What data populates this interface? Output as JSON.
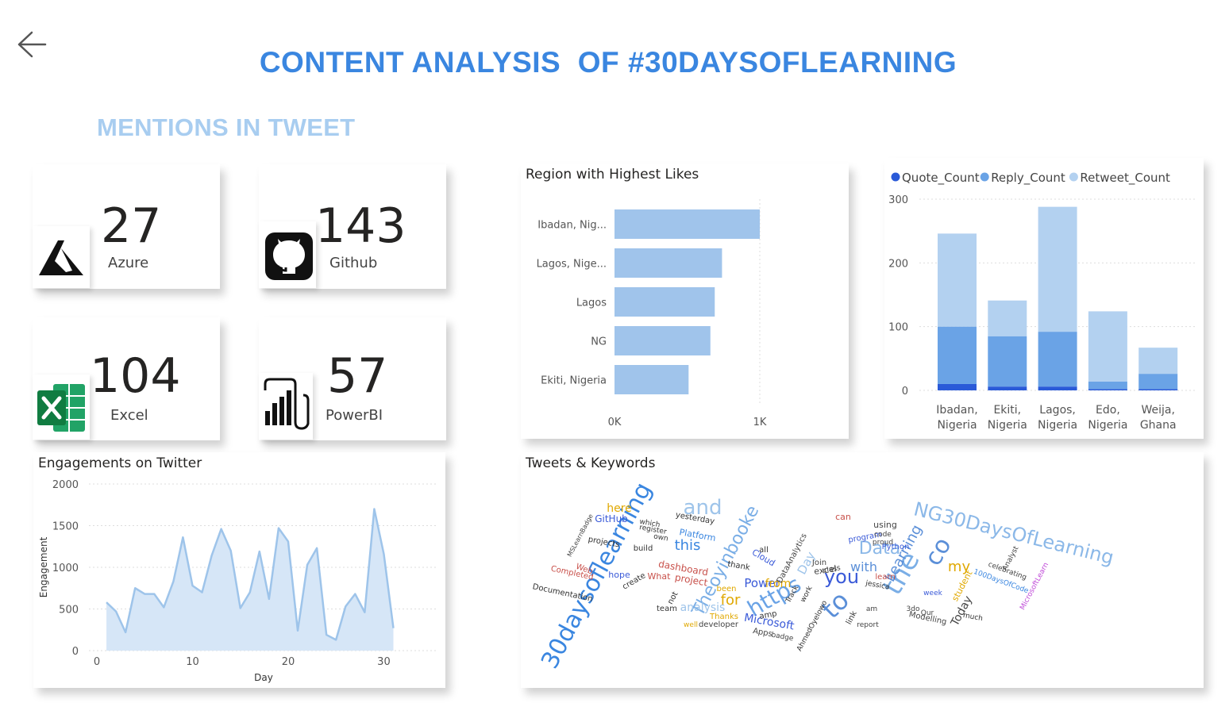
{
  "header": {
    "title": "CONTENT ANALYSIS  OF #30DAYSOFLEARNING",
    "subtitle": "MENTIONS IN TWEET"
  },
  "kpis": [
    {
      "value": "27",
      "label": "Azure",
      "icon": "azure-icon"
    },
    {
      "value": "143",
      "label": "Github",
      "icon": "github-icon"
    },
    {
      "value": "104",
      "label": "Excel",
      "icon": "excel-icon"
    },
    {
      "value": "57",
      "label": "PowerBI",
      "icon": "powerbi-icon"
    }
  ],
  "colors": {
    "title": "#3a86e0",
    "subtitle": "#a8cdf0",
    "bar": "#a0c4eb",
    "quote": "#2a5ad8",
    "reply": "#6aa3e6",
    "retweet": "#b3d1f0",
    "line": "#9ec4ea",
    "area": "#d6e6f7"
  },
  "chart_data": [
    {
      "id": "region_likes",
      "type": "bar",
      "orientation": "horizontal",
      "title": "Region with Highest Likes",
      "categories": [
        "Ibadan, Nig...",
        "Lagos, Nige...",
        "Lagos",
        "NG",
        "Ekiti, Nigeria"
      ],
      "values": [
        1000,
        740,
        690,
        660,
        510
      ],
      "xlim": [
        0,
        1000
      ],
      "xticks": [
        "0K",
        "1K"
      ]
    },
    {
      "id": "engagement_counts",
      "type": "bar",
      "stacked": true,
      "legend": "top-left",
      "categories": [
        "Ibadan, Nigeria",
        "Ekiti, Nigeria",
        "Lagos, Nigeria",
        "Edo, Nigeria",
        "Weija, Ghana"
      ],
      "category_lines": [
        [
          "Ibadan,",
          "Nigeria"
        ],
        [
          "Ekiti,",
          "Nigeria"
        ],
        [
          "Lagos,",
          "Nigeria"
        ],
        [
          "Edo,",
          "Nigeria"
        ],
        [
          "Weija,",
          "Ghana"
        ]
      ],
      "series": [
        {
          "name": "Quote_Count",
          "values": [
            10,
            6,
            6,
            2,
            2
          ]
        },
        {
          "name": "Reply_Count",
          "values": [
            90,
            79,
            86,
            12,
            24
          ]
        },
        {
          "name": "Retweet_Count",
          "values": [
            146,
            56,
            196,
            110,
            41
          ]
        }
      ],
      "ylim": [
        0,
        300
      ],
      "yticks": [
        0,
        100,
        200,
        300
      ]
    },
    {
      "id": "engagements_twitter",
      "type": "area",
      "title": "Engagements on Twitter",
      "xlabel": "Day",
      "ylabel": "Engagement",
      "xlim": [
        0,
        35
      ],
      "ylim": [
        0,
        2000
      ],
      "xticks": [
        0,
        10,
        20,
        30
      ],
      "yticks": [
        0,
        500,
        1000,
        1500,
        2000
      ],
      "x": [
        1,
        2,
        3,
        4,
        5,
        6,
        7,
        8,
        9,
        10,
        11,
        12,
        13,
        14,
        15,
        16,
        17,
        18,
        19,
        20,
        21,
        22,
        23,
        24,
        25,
        26,
        27,
        28,
        29,
        30,
        31
      ],
      "y": [
        580,
        470,
        220,
        750,
        680,
        680,
        520,
        830,
        1360,
        780,
        700,
        1140,
        1460,
        1200,
        510,
        700,
        1190,
        620,
        1470,
        1310,
        240,
        1030,
        1230,
        190,
        130,
        530,
        680,
        460,
        1700,
        1160,
        270
      ]
    }
  ],
  "wordcloud": {
    "title": "Tweets & Keywords",
    "words": [
      {
        "t": "30daysoflearning",
        "x": 760,
        "y": 730,
        "s": 30,
        "r": -62,
        "c": "#3a86e0"
      },
      {
        "t": "NG30DaysOfLearning",
        "x": 1275,
        "y": 680,
        "s": 24,
        "r": 14,
        "c": "#8bb8e8"
      },
      {
        "t": "the",
        "x": 1145,
        "y": 728,
        "s": 34,
        "r": -60,
        "c": "#7aaee6"
      },
      {
        "t": "to",
        "x": 1060,
        "y": 770,
        "s": 32,
        "r": -45,
        "c": "#5b8fd8"
      },
      {
        "t": "co",
        "x": 1190,
        "y": 700,
        "s": 30,
        "r": -60,
        "c": "#5b8fd8"
      },
      {
        "t": "https",
        "x": 980,
        "y": 760,
        "s": 28,
        "r": -30,
        "c": "#6aa3e6"
      },
      {
        "t": "you",
        "x": 1060,
        "y": 735,
        "s": 24,
        "r": 0,
        "c": "#3a5ad8"
      },
      {
        "t": "and",
        "x": 885,
        "y": 648,
        "s": 26,
        "r": 0,
        "c": "#9ec4ea"
      },
      {
        "t": "Theoyinbooke",
        "x": 920,
        "y": 710,
        "s": 22,
        "r": -62,
        "c": "#7aaee6"
      },
      {
        "t": "Data",
        "x": 1108,
        "y": 698,
        "s": 22,
        "r": 0,
        "c": "#8bb8e8"
      },
      {
        "t": "Learning",
        "x": 1143,
        "y": 700,
        "s": 18,
        "r": -62,
        "c": "#5b8fd8"
      },
      {
        "t": "this",
        "x": 866,
        "y": 693,
        "s": 18,
        "r": 0,
        "c": "#3a86e0"
      },
      {
        "t": "for",
        "x": 920,
        "y": 762,
        "s": 18,
        "r": 0,
        "c": "#e0a800"
      },
      {
        "t": "Power",
        "x": 960,
        "y": 740,
        "s": 15,
        "r": 0,
        "c": "#3a5ad8"
      },
      {
        "t": "Microsoft",
        "x": 968,
        "y": 788,
        "s": 14,
        "r": 10,
        "c": "#3a5ad8"
      },
      {
        "t": "analysis",
        "x": 885,
        "y": 770,
        "s": 14,
        "r": 0,
        "c": "#9ec4ea"
      },
      {
        "t": "with",
        "x": 1088,
        "y": 720,
        "s": 16,
        "r": 0,
        "c": "#5b8fd8"
      },
      {
        "t": "here",
        "x": 780,
        "y": 645,
        "s": 14,
        "r": 0,
        "c": "#e0a800"
      },
      {
        "t": "GitHub",
        "x": 770,
        "y": 658,
        "s": 12,
        "r": 0,
        "c": "#3a5ad8"
      },
      {
        "t": "Documentation",
        "x": 708,
        "y": 750,
        "s": 10,
        "r": 12,
        "c": "#333"
      },
      {
        "t": "Platform",
        "x": 878,
        "y": 678,
        "s": 11,
        "r": 10,
        "c": "#3a86e0"
      },
      {
        "t": "dashboard",
        "x": 860,
        "y": 720,
        "s": 12,
        "r": 10,
        "c": "#c8504a"
      },
      {
        "t": "project",
        "x": 870,
        "y": 735,
        "s": 12,
        "r": 10,
        "c": "#c8504a"
      },
      {
        "t": "my",
        "x": 1208,
        "y": 720,
        "s": 18,
        "r": 0,
        "c": "#e0a800"
      },
      {
        "t": "Today",
        "x": 1215,
        "y": 772,
        "s": 14,
        "r": -62,
        "c": "#444"
      },
      {
        "t": "Python",
        "x": 1128,
        "y": 692,
        "s": 10,
        "r": 0,
        "c": "#3a5ad8"
      },
      {
        "t": "program",
        "x": 1090,
        "y": 680,
        "s": 10,
        "r": -10,
        "c": "#3a5ad8"
      },
      {
        "t": "excel",
        "x": 1040,
        "y": 722,
        "s": 11,
        "r": -8,
        "c": "#444"
      },
      {
        "t": "Cloud",
        "x": 960,
        "y": 706,
        "s": 11,
        "r": 30,
        "c": "#3a5ad8"
      },
      {
        "t": "from",
        "x": 980,
        "y": 740,
        "s": 14,
        "r": 0,
        "c": "#e0a800"
      },
      {
        "t": "student",
        "x": 1215,
        "y": 740,
        "s": 11,
        "r": -62,
        "c": "#e0a800"
      },
      {
        "t": "yesterday",
        "x": 875,
        "y": 656,
        "s": 10,
        "r": 10,
        "c": "#333"
      },
      {
        "t": "projects",
        "x": 760,
        "y": 686,
        "s": 10,
        "r": 10,
        "c": "#333"
      },
      {
        "t": "Completed",
        "x": 720,
        "y": 725,
        "s": 10,
        "r": 12,
        "c": "#c8504a"
      },
      {
        "t": "MicrosoftLearn",
        "x": 1305,
        "y": 740,
        "s": 9,
        "r": -62,
        "c": "#c04bd8"
      },
      {
        "t": "100DaysOfCode",
        "x": 1260,
        "y": 735,
        "s": 9,
        "r": 20,
        "c": "#3a86e0"
      },
      {
        "t": "celebrating",
        "x": 1268,
        "y": 722,
        "s": 9,
        "r": 20,
        "c": "#444"
      },
      {
        "t": "Analyst",
        "x": 1275,
        "y": 705,
        "s": 9,
        "r": -62,
        "c": "#444"
      },
      {
        "t": "Modelling",
        "x": 1168,
        "y": 782,
        "s": 10,
        "r": 12,
        "c": "#444"
      },
      {
        "t": "learn",
        "x": 1115,
        "y": 730,
        "s": 10,
        "r": 0,
        "c": "#c8504a"
      },
      {
        "t": "jessica",
        "x": 1105,
        "y": 740,
        "s": 9,
        "r": 10,
        "c": "#333"
      },
      {
        "t": "build",
        "x": 810,
        "y": 694,
        "s": 10,
        "r": 0,
        "c": "#333"
      },
      {
        "t": "create",
        "x": 800,
        "y": 735,
        "s": 10,
        "r": -30,
        "c": "#333"
      },
      {
        "t": "amp",
        "x": 968,
        "y": 778,
        "s": 10,
        "r": -10,
        "c": "#333"
      },
      {
        "t": "Apps",
        "x": 960,
        "y": 800,
        "s": 10,
        "r": 10,
        "c": "#444"
      },
      {
        "t": "badge",
        "x": 985,
        "y": 805,
        "s": 9,
        "r": 10,
        "c": "#444"
      },
      {
        "t": "developer",
        "x": 905,
        "y": 790,
        "s": 10,
        "r": 0,
        "c": "#444"
      },
      {
        "t": "Thanks",
        "x": 912,
        "y": 780,
        "s": 10,
        "r": 0,
        "c": "#e0a800"
      },
      {
        "t": "well",
        "x": 870,
        "y": 790,
        "s": 9,
        "r": 0,
        "c": "#e0a800"
      },
      {
        "t": "team",
        "x": 840,
        "y": 770,
        "s": 10,
        "r": 0,
        "c": "#333"
      },
      {
        "t": "not",
        "x": 850,
        "y": 755,
        "s": 10,
        "r": -62,
        "c": "#333"
      },
      {
        "t": "What",
        "x": 830,
        "y": 730,
        "s": 11,
        "r": 0,
        "c": "#c8504a"
      },
      {
        "t": "hope",
        "x": 780,
        "y": 728,
        "s": 11,
        "r": 0,
        "c": "#3a5ad8"
      },
      {
        "t": "Web",
        "x": 735,
        "y": 720,
        "s": 10,
        "r": 20,
        "c": "#c8504a"
      },
      {
        "t": "MSLearnBadge",
        "x": 733,
        "y": 676,
        "s": 8,
        "r": -62,
        "c": "#444"
      },
      {
        "t": "which",
        "x": 818,
        "y": 662,
        "s": 9,
        "r": 10,
        "c": "#333"
      },
      {
        "t": "register",
        "x": 822,
        "y": 670,
        "s": 9,
        "r": 10,
        "c": "#333"
      },
      {
        "t": "own",
        "x": 832,
        "y": 680,
        "s": 9,
        "r": 10,
        "c": "#333"
      },
      {
        "t": "thank",
        "x": 930,
        "y": 716,
        "s": 10,
        "r": 10,
        "c": "#333"
      },
      {
        "t": "been",
        "x": 915,
        "y": 745,
        "s": 10,
        "r": 0,
        "c": "#e0a800"
      },
      {
        "t": "all",
        "x": 962,
        "y": 696,
        "s": 10,
        "r": 0,
        "c": "#333"
      },
      {
        "t": "Day",
        "x": 1020,
        "y": 712,
        "s": 15,
        "r": -62,
        "c": "#9ec4ea"
      },
      {
        "t": "DataAnalytics",
        "x": 1000,
        "y": 705,
        "s": 10,
        "r": -62,
        "c": "#444"
      },
      {
        "t": "Join",
        "x": 1032,
        "y": 712,
        "s": 10,
        "r": 0,
        "c": "#444"
      },
      {
        "t": "class",
        "x": 1048,
        "y": 720,
        "s": 9,
        "r": -10,
        "c": "#333"
      },
      {
        "t": "using",
        "x": 1115,
        "y": 665,
        "s": 11,
        "r": 0,
        "c": "#444"
      },
      {
        "t": "code",
        "x": 1112,
        "y": 676,
        "s": 9,
        "r": 0,
        "c": "#444"
      },
      {
        "t": "proud",
        "x": 1112,
        "y": 686,
        "s": 9,
        "r": 0,
        "c": "#444"
      },
      {
        "t": "can",
        "x": 1062,
        "y": 655,
        "s": 11,
        "r": 0,
        "c": "#c8504a"
      },
      {
        "t": "week",
        "x": 1175,
        "y": 750,
        "s": 9,
        "r": 0,
        "c": "#3a5ad8"
      },
      {
        "t": "Our",
        "x": 1168,
        "y": 775,
        "s": 9,
        "r": 0,
        "c": "#444"
      },
      {
        "t": "3do",
        "x": 1150,
        "y": 770,
        "s": 9,
        "r": 0,
        "c": "#444"
      },
      {
        "t": "am",
        "x": 1098,
        "y": 770,
        "s": 9,
        "r": 0,
        "c": "#444"
      },
      {
        "t": "report",
        "x": 1093,
        "y": 790,
        "s": 9,
        "r": 0,
        "c": "#444"
      },
      {
        "t": "link",
        "x": 1075,
        "y": 780,
        "s": 10,
        "r": -62,
        "c": "#333"
      },
      {
        "t": "work",
        "x": 1018,
        "y": 750,
        "s": 9,
        "r": -62,
        "c": "#333"
      },
      {
        "t": "AhmedOyelowo",
        "x": 1025,
        "y": 790,
        "s": 9,
        "r": -62,
        "c": "#333"
      },
      {
        "t": "Track",
        "x": 1000,
        "y": 750,
        "s": 9,
        "r": -62,
        "c": "#333"
      },
      {
        "t": "much",
        "x": 1225,
        "y": 780,
        "s": 9,
        "r": 10,
        "c": "#333"
      }
    ]
  }
}
